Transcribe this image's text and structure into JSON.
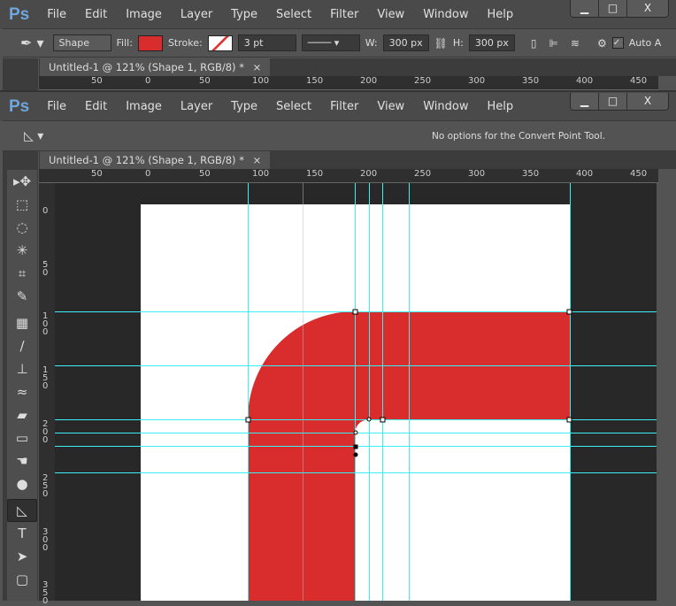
{
  "app_logo": "Ps",
  "menu": [
    "File",
    "Edit",
    "Image",
    "Layer",
    "Type",
    "Select",
    "Filter",
    "View",
    "Window",
    "Help"
  ],
  "window_buttons": [
    "▁",
    "□",
    "X"
  ],
  "window1": {
    "options": {
      "mode": "Shape",
      "fill_label": "Fill:",
      "stroke_label": "Stroke:",
      "stroke_width": "3 pt",
      "w_label": "W:",
      "w_value": "300 px",
      "h_label": "H:",
      "h_value": "300 px",
      "auto_label": "Auto A"
    },
    "tab": "Untitled-1 @ 121% (Shape 1, RGB/8) *"
  },
  "window2": {
    "options": {
      "message": "No options for the Convert Point Tool."
    },
    "tab": "Untitled-1 @ 121% (Shape 1, RGB/8) *"
  },
  "hruler_labels": [
    "50",
    "0",
    "50",
    "100",
    "150",
    "200",
    "250",
    "300",
    "350",
    "400",
    "450"
  ],
  "vruler_labels": [
    "0",
    "50",
    "100",
    "150",
    "200",
    "250",
    "300",
    "350"
  ],
  "tools": [
    {
      "name": "move",
      "glyph": "▸✥"
    },
    {
      "name": "marquee",
      "glyph": "⬚"
    },
    {
      "name": "lasso",
      "glyph": "◌"
    },
    {
      "name": "magic-wand",
      "glyph": "✳"
    },
    {
      "name": "crop",
      "glyph": "⌗"
    },
    {
      "name": "eyedropper",
      "glyph": "✎"
    },
    {
      "name": "healing",
      "glyph": "▦"
    },
    {
      "name": "brush",
      "glyph": "∕"
    },
    {
      "name": "stamp",
      "glyph": "⊥"
    },
    {
      "name": "history-brush",
      "glyph": "≈"
    },
    {
      "name": "eraser",
      "glyph": "▰"
    },
    {
      "name": "gradient",
      "glyph": "▭"
    },
    {
      "name": "smudge",
      "glyph": "☚"
    },
    {
      "name": "dodge",
      "glyph": "●"
    },
    {
      "name": "convert-point",
      "glyph": "◺"
    },
    {
      "name": "type",
      "glyph": "T"
    },
    {
      "name": "path-selection",
      "glyph": "➤"
    },
    {
      "name": "rectangle",
      "glyph": "▢"
    }
  ],
  "colors": {
    "fill": "#d92d2d",
    "guide": "#39f0f5",
    "canvas_bg": "#282828"
  }
}
